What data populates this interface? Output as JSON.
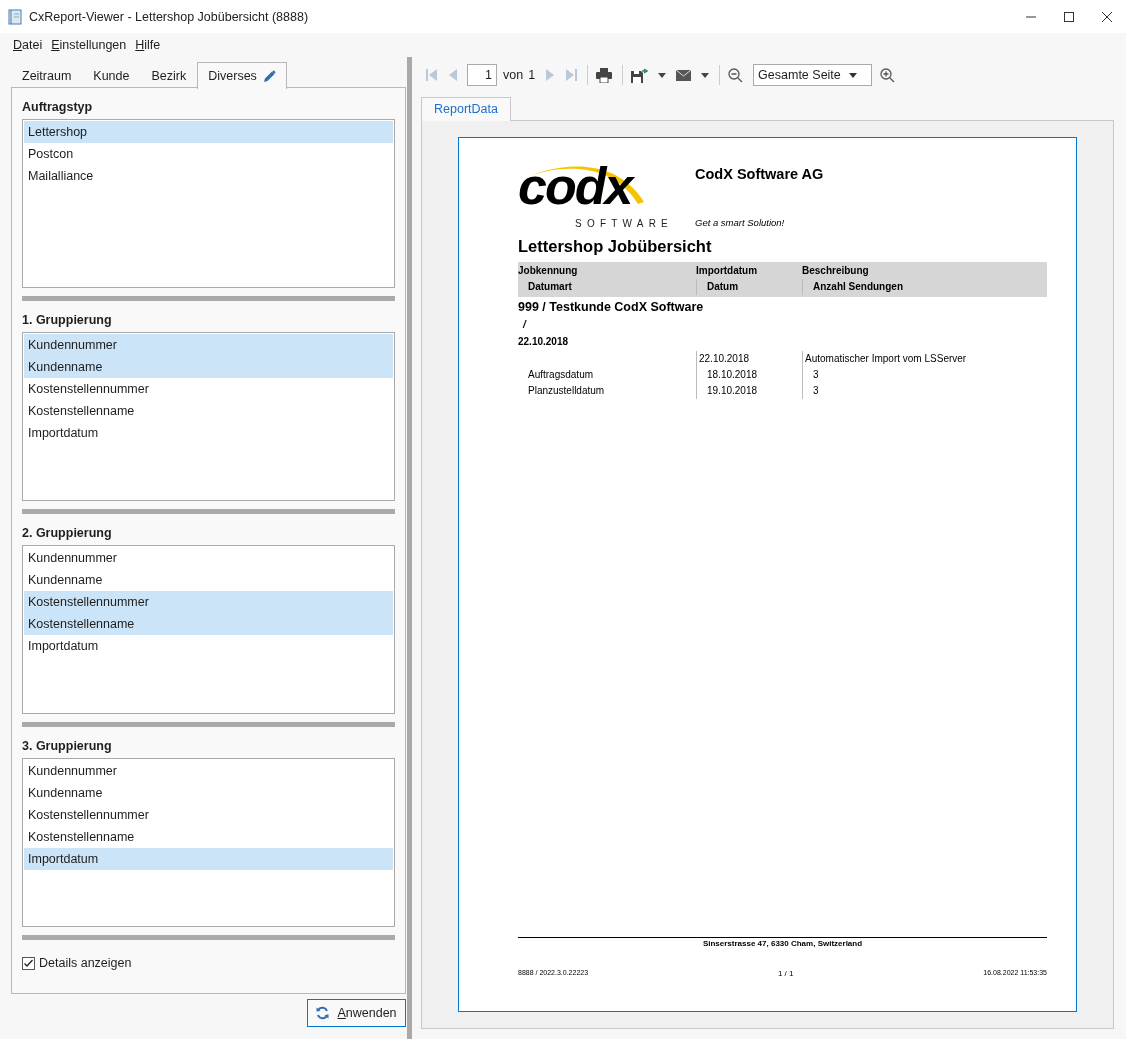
{
  "window": {
    "title": "CxReport-Viewer - Lettershop Jobübersicht (8888)"
  },
  "menu": [
    "Datei",
    "Einstellungen",
    "Hilfe"
  ],
  "filter_tabs": [
    {
      "label": "Zeitraum",
      "selected": false,
      "edited": false
    },
    {
      "label": "Kunde",
      "selected": false,
      "edited": false
    },
    {
      "label": "Bezirk",
      "selected": false,
      "edited": false
    },
    {
      "label": "Diverses",
      "selected": true,
      "edited": true
    }
  ],
  "sections": [
    {
      "title": "Auftragstyp",
      "items": [
        {
          "label": "Lettershop",
          "selected": true
        },
        {
          "label": "Postcon",
          "selected": false
        },
        {
          "label": "Mailalliance",
          "selected": false
        }
      ]
    },
    {
      "title": "1. Gruppierung",
      "items": [
        {
          "label": "Kundennummer",
          "selected": true
        },
        {
          "label": "Kundenname",
          "selected": true
        },
        {
          "label": "Kostenstellennummer",
          "selected": false
        },
        {
          "label": "Kostenstellenname",
          "selected": false
        },
        {
          "label": "Importdatum",
          "selected": false
        }
      ]
    },
    {
      "title": "2. Gruppierung",
      "items": [
        {
          "label": "Kundennummer",
          "selected": false
        },
        {
          "label": "Kundenname",
          "selected": false
        },
        {
          "label": "Kostenstellennummer",
          "selected": true
        },
        {
          "label": "Kostenstellenname",
          "selected": true
        },
        {
          "label": "Importdatum",
          "selected": false
        }
      ]
    },
    {
      "title": "3. Gruppierung",
      "items": [
        {
          "label": "Kundennummer",
          "selected": false
        },
        {
          "label": "Kundenname",
          "selected": false
        },
        {
          "label": "Kostenstellennummer",
          "selected": false
        },
        {
          "label": "Kostenstellenname",
          "selected": false
        },
        {
          "label": "Importdatum",
          "selected": true
        }
      ]
    }
  ],
  "details_checkbox": {
    "label": "Details anzeigen",
    "checked": true
  },
  "apply_button": {
    "label": "Anwenden"
  },
  "viewer_toolbar": {
    "page": "1",
    "of_label": "von",
    "page_count": "1",
    "zoom": "Gesamte Seite"
  },
  "report_tabs": [
    {
      "label": "ReportData",
      "selected": true
    }
  ],
  "report": {
    "logo_text": "codx",
    "logo_subtext": "SOFTWARE",
    "company": "CodX Software AG",
    "slogan": "Get a smart Solution!",
    "title": "Lettershop Jobübersicht",
    "header_rows": [
      [
        "Jobkennung",
        "Importdatum",
        "Beschreibung"
      ],
      [
        "Datumart",
        "Datum",
        "Anzahl Sendungen"
      ]
    ],
    "group_title": "999 / Testkunde CodX Software",
    "group_subtitle": "/",
    "date_group": "22.10.2018",
    "rows": [
      {
        "kind": "import",
        "date": "22.10.2018",
        "text": "Automatischer Import vom LSServer"
      },
      {
        "kind": "detail",
        "label": "Auftragsdatum",
        "date": "18.10.2018",
        "text": "3"
      },
      {
        "kind": "detail",
        "label": "Planzustelldatum",
        "date": "19.10.2018",
        "text": "3"
      }
    ],
    "footer_address": "Sinserstrasse 47, 6330 Cham, Switzerland",
    "footer_left": "8888 / 2022.3.0.22223",
    "footer_center": "1 / 1",
    "footer_right": "16.08.2022 11:53:35"
  }
}
